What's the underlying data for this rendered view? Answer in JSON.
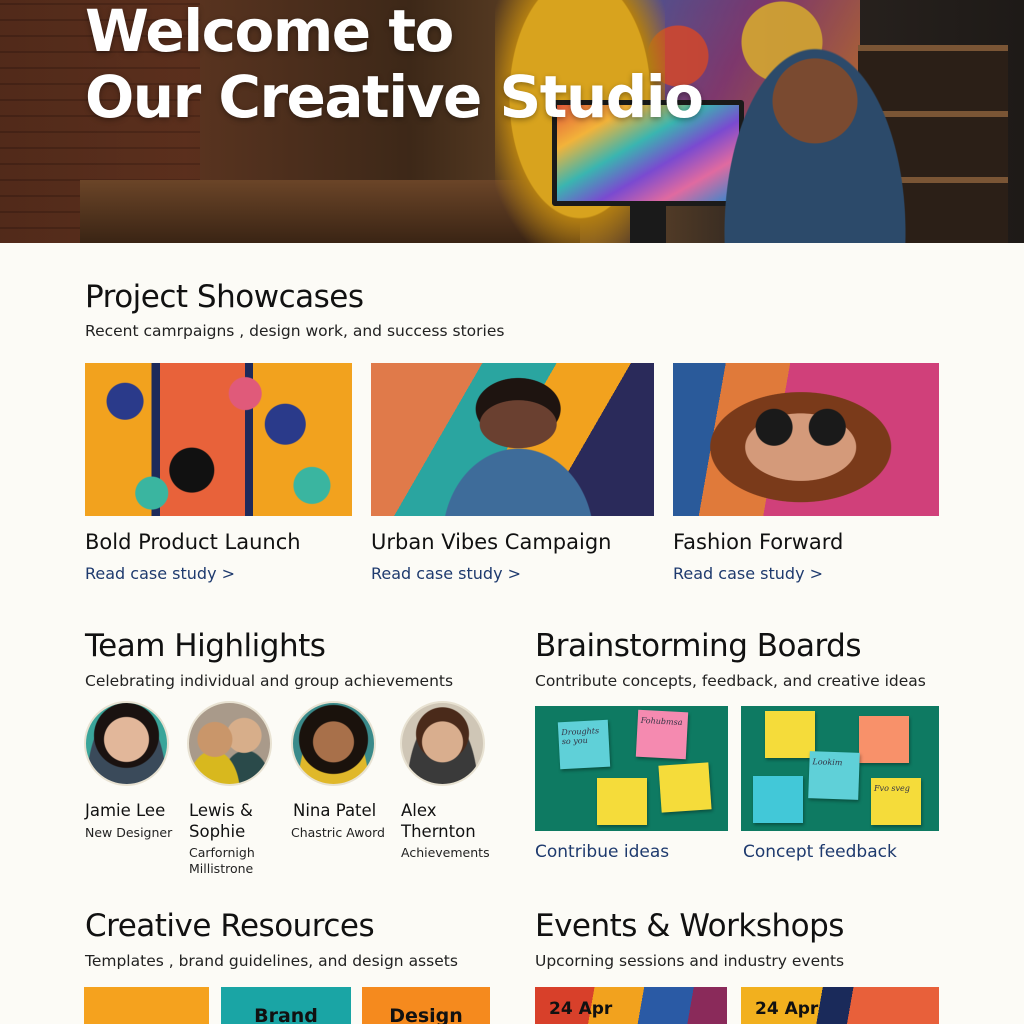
{
  "hero": {
    "title_line1": "Welcome to",
    "title_line2": "Our Creative Studio"
  },
  "showcase": {
    "title": "Project Showcases",
    "subtitle": "Recent camrpaigns , design work, and success stories",
    "cards": [
      {
        "title": "Bold Product Launch",
        "link": "Read case study >"
      },
      {
        "title": "Urban Vibes Campaign",
        "link": "Read case study >"
      },
      {
        "title": "Fashion Forward",
        "link": "Read case study >"
      }
    ]
  },
  "team": {
    "title": "Team Highlights",
    "subtitle": "Celebrating individual and group achievements",
    "members": [
      {
        "name": "Jamie Lee",
        "role": "New Designer"
      },
      {
        "name_line1": "Lewis &",
        "name_line2": "Sophie",
        "role_line1": "Carfornigh",
        "role_line2": "Millistrone"
      },
      {
        "name": "Nina Patel",
        "role": "Chastric Aword"
      },
      {
        "name_line1": "Alex",
        "name_line2": "Thernton",
        "role": "Achievements"
      }
    ]
  },
  "brainstorm": {
    "title": "Brainstorming Boards",
    "subtitle": "Contribute concepts, feedback, and creative ideas",
    "boards": [
      {
        "link": "Contribue ideas",
        "notes": [
          "Droughts so you",
          "Fohubmsa"
        ]
      },
      {
        "link": "Concept feedback",
        "notes": [
          "Lookim",
          "Fvo sveg"
        ]
      }
    ]
  },
  "resources": {
    "title": "Creative Resources",
    "subtitle": "Templates , brand guidelines, and design assets",
    "tiles": [
      "",
      "Brand",
      "Design"
    ]
  },
  "events": {
    "title": "Events & Workshops",
    "subtitle": "Upcorning sessions and industry events",
    "items": [
      {
        "date": "24 Apr"
      },
      {
        "date": "24 Apr"
      }
    ]
  },
  "colors": {
    "background": "#fcfbf6",
    "link": "#1e3a6e",
    "board": "#0e7a62"
  }
}
